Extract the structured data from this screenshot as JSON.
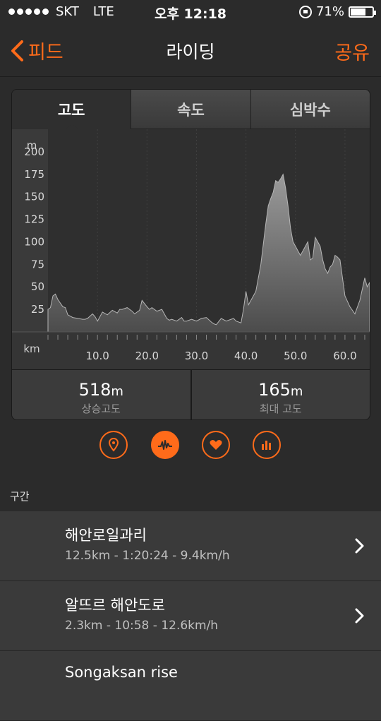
{
  "status_bar": {
    "carrier": "SKT",
    "network": "LTE",
    "time": "오후 12:18",
    "battery": "71%",
    "battery_level": 0.71
  },
  "nav": {
    "back_label": "피드",
    "title": "라이딩",
    "share_label": "공유"
  },
  "tabs": [
    {
      "label": "고도",
      "active": true
    },
    {
      "label": "속도",
      "active": false
    },
    {
      "label": "심박수",
      "active": false
    }
  ],
  "chart_data": {
    "type": "area",
    "ylabel": "m",
    "xlabel": "km",
    "ylim": [
      0,
      225
    ],
    "xlim": [
      0,
      65
    ],
    "yticks": [
      25,
      50,
      75,
      100,
      125,
      150,
      175,
      200
    ],
    "xticks": [
      10.0,
      20.0,
      30.0,
      40.0,
      50.0,
      60.0
    ],
    "xtick_labels": [
      "10.0",
      "20.0",
      "30.0",
      "40.0",
      "50.0",
      "60.0"
    ],
    "ytick_labels": [
      "25",
      "50",
      "75",
      "100",
      "125",
      "150",
      "175",
      "200"
    ],
    "fill_color": "#8a8a8a",
    "x": [
      0,
      0.5,
      1,
      1.5,
      2,
      3,
      3.5,
      4,
      5,
      6,
      7,
      7.5,
      8,
      9,
      9.5,
      10,
      11,
      12,
      13,
      14,
      14.5,
      15,
      16,
      17,
      17.5,
      18,
      18.5,
      19,
      20,
      20.5,
      21,
      22,
      23,
      24,
      24.5,
      25,
      26,
      27,
      27.5,
      28,
      29,
      29.5,
      30,
      31,
      32,
      33,
      33.5,
      34,
      35,
      36,
      37,
      37.5,
      38,
      39,
      39.5,
      40,
      40.5,
      41,
      42,
      43,
      44,
      44.5,
      45,
      45.5,
      46,
      46.5,
      47,
      47.5,
      48,
      48.5,
      49,
      49.5,
      50,
      50.5,
      51,
      51.5,
      52,
      52.5,
      53,
      53.5,
      54,
      54.5,
      55,
      55.5,
      56,
      56.5,
      57,
      57.5,
      58,
      58.5,
      59,
      59.5,
      60,
      61,
      62,
      63,
      64,
      64.5,
      65
    ],
    "y": [
      25,
      27,
      40,
      42,
      36,
      28,
      27,
      19,
      16,
      15,
      14,
      14,
      15,
      20,
      17,
      12,
      22,
      19,
      24,
      21,
      25,
      25,
      27,
      23,
      20,
      22,
      24,
      35,
      28,
      25,
      27,
      23,
      25,
      15,
      13,
      14,
      12,
      16,
      12,
      12,
      14,
      13,
      12,
      15,
      16,
      11,
      9,
      8,
      15,
      12,
      14,
      15,
      12,
      10,
      25,
      45,
      30,
      35,
      45,
      75,
      120,
      140,
      148,
      155,
      168,
      166,
      170,
      175,
      160,
      140,
      115,
      100,
      95,
      90,
      85,
      90,
      95,
      100,
      80,
      82,
      105,
      100,
      95,
      80,
      70,
      65,
      72,
      75,
      85,
      83,
      80,
      60,
      40,
      28,
      20,
      35,
      60,
      50,
      55
    ],
    "stats": [
      {
        "value": "518",
        "unit": "m",
        "label": "상승고도"
      },
      {
        "value": "165",
        "unit": "m",
        "label": "최대 고도"
      }
    ]
  },
  "action_icons": [
    {
      "name": "map-pin-icon",
      "active": false
    },
    {
      "name": "activity-graph-icon",
      "active": true
    },
    {
      "name": "heart-icon",
      "active": false
    },
    {
      "name": "bar-chart-icon",
      "active": false
    }
  ],
  "section": {
    "label": "구간"
  },
  "segments": [
    {
      "name": "해안로일과리",
      "meta": "12.5km - 1:20:24 - 9.4km/h"
    },
    {
      "name": "알뜨르 해안도로",
      "meta": "2.3km - 10:58 - 12.6km/h"
    },
    {
      "name": "Songaksan rise",
      "meta": ""
    }
  ],
  "colors": {
    "accent": "#ff6b1a",
    "background": "#2b2b2b"
  }
}
